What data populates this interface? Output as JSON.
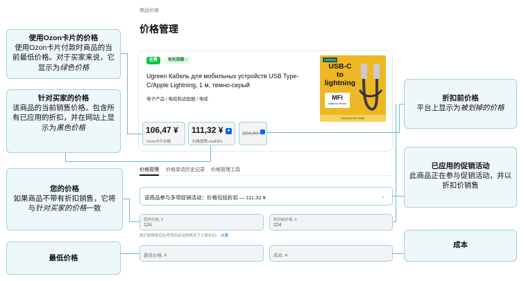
{
  "page": {
    "breadcrumb": "商品价格",
    "title": "价格管理"
  },
  "product": {
    "badge_new": "在售",
    "badge_best": "有利指数 ›",
    "title": "Ugreen Кабель для мобильных устройств USB Type-C/Apple Lightning, 1 м, темно-серый",
    "category": "电子产品 / 电缆和适配器 / 电缆",
    "image": {
      "brand": "UGREEN",
      "text_line1": "USB-C",
      "text_line2": "to",
      "text_line3": "lightning",
      "mfi": "MFi",
      "mfi_small": "Made for iPhone",
      "strip": "Gaming & fast charge"
    }
  },
  "prices": {
    "ozon_card_value": "106,47 ¥",
    "ozon_card_label": "Ozon卡片价格",
    "buyer_value": "111,32 ¥",
    "buyer_label": "价格按照 realFBS",
    "before_discount_value": "224,00 ¥",
    "info_icon": "info-icon"
  },
  "tabs": [
    {
      "label": "价格管理",
      "active": true
    },
    {
      "label": "价格变动历史记录",
      "active": false
    },
    {
      "label": "价格管理工具",
      "active": false
    }
  ],
  "promo_select": {
    "value": "该商品参与多项促销活动：价格包括折扣 — 111,32 ¥",
    "chevron": "chevron-down-icon"
  },
  "fields": {
    "your_price_label": "您的价格, ¥",
    "your_price_value": "124",
    "before_discount_label": "折扣前价格, ¥",
    "before_discount_value": "224",
    "hint_text": "我们将帮助您在考虑到关闭的情况下计算折扣。",
    "hint_link": "计算",
    "min_price_placeholder": "最低价格, ¥",
    "cost_placeholder": "成本, ¥"
  },
  "callouts": {
    "ozon_card": {
      "title": "使用Ozon卡片的价格",
      "text1": "使用Ozon卡片付款时商品的当前最低价格。对于买家来说，它显示为",
      "em": "绿色价格"
    },
    "buyer_price": {
      "title": "针对买家的价格",
      "text1": "该商品的当前销售价格。包含所有已应用的折扣，并在网站上显示为",
      "em": "黑色价格"
    },
    "your_price": {
      "title": "您的价格",
      "text1": "如果商品不带有折扣销售，它将与",
      "em": "针对买家的价格",
      "text2": "一致"
    },
    "min_price": {
      "title": "最低价格"
    },
    "before_discount": {
      "title": "折扣前价格",
      "text1": "平台上显示为",
      "em": "被划掉的价格"
    },
    "promo": {
      "title": "已应用的促销活动",
      "text1": "此商品正在参与促销活动，并以折扣价销售"
    },
    "cost": {
      "title": "成本"
    }
  },
  "colors": {
    "accent_line": "#6fb6c4",
    "callout_bg": "#eef7f9",
    "badge_green": "#10c44c",
    "link_blue": "#0a63ff"
  }
}
